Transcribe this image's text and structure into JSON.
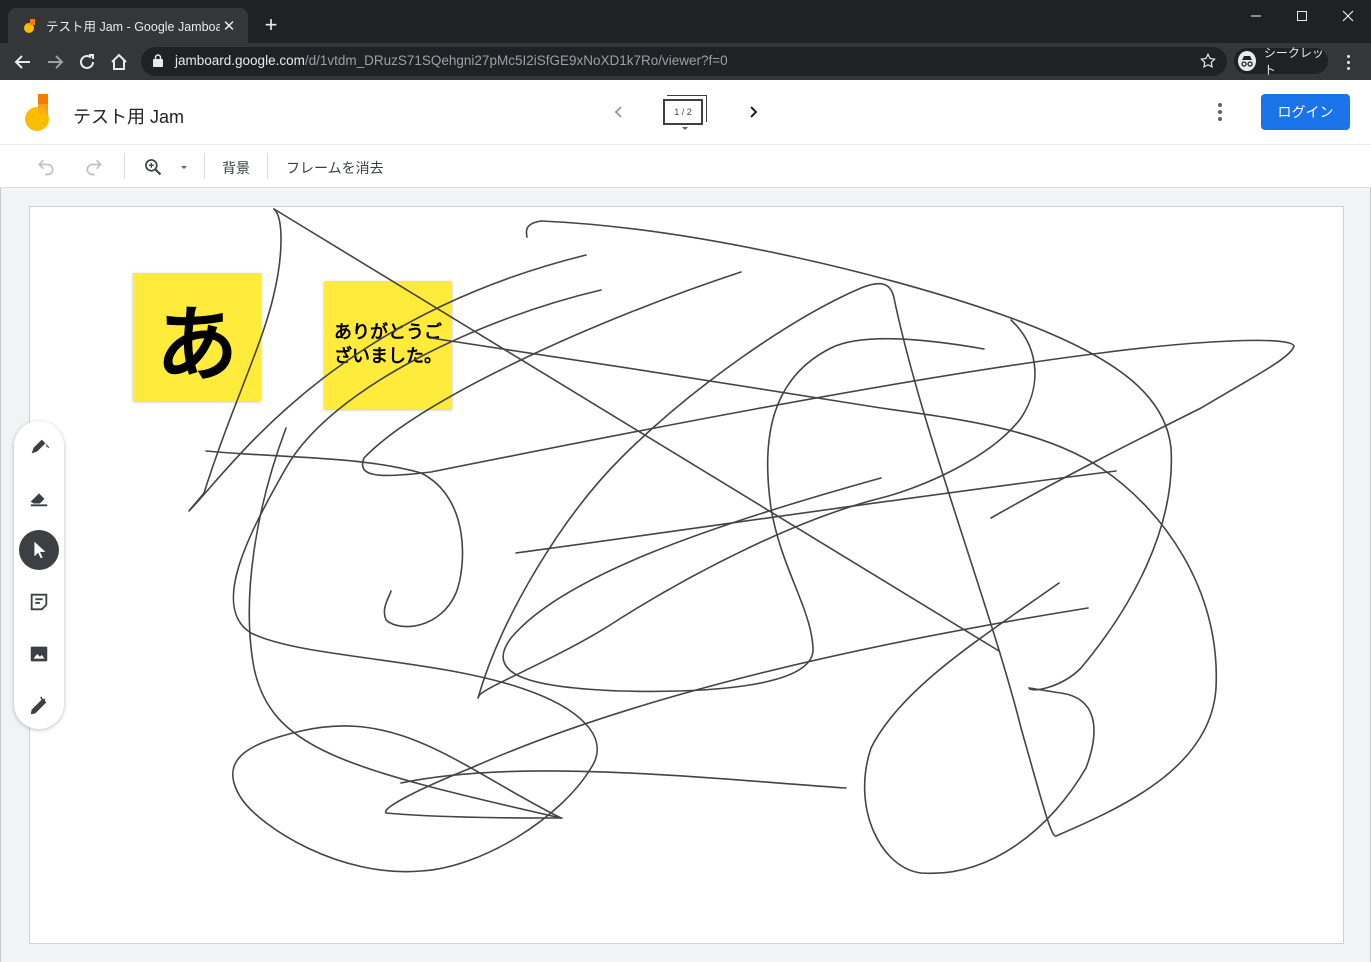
{
  "browser": {
    "tab_title": "テスト用 Jam - Google Jamboard",
    "tab_close": "✕",
    "new_tab": "+",
    "url_host": "jamboard.google.com",
    "url_path": "/d/1vtdm_DRuzS71SQehgni27pMc5I2iSfGE9xNoXD1k7Ro/viewer?f=0",
    "incognito_label": "シークレット"
  },
  "header": {
    "doc_title": "テスト用 Jam",
    "frame_counter": "1 / 2",
    "login_label": "ログイン"
  },
  "toolbar": {
    "background_label": "背景",
    "clear_frame_label": "フレームを消去"
  },
  "canvas": {
    "sticky_notes": [
      {
        "text": "あ",
        "color": "#ffeb3b"
      },
      {
        "text": "ありがとうございました。",
        "color": "#ffeb3b"
      }
    ],
    "ink_color": "#444444"
  },
  "palette": {
    "tools": [
      "pen-icon",
      "eraser-icon",
      "select-icon",
      "sticky-note-icon",
      "image-icon",
      "laser-icon"
    ],
    "active_tool": "select-icon"
  },
  "colors": {
    "chrome_dark": "#202124",
    "chrome_toolbar": "#35363a",
    "accent": "#1a73e8",
    "sticky_yellow": "#ffeb3b"
  }
}
